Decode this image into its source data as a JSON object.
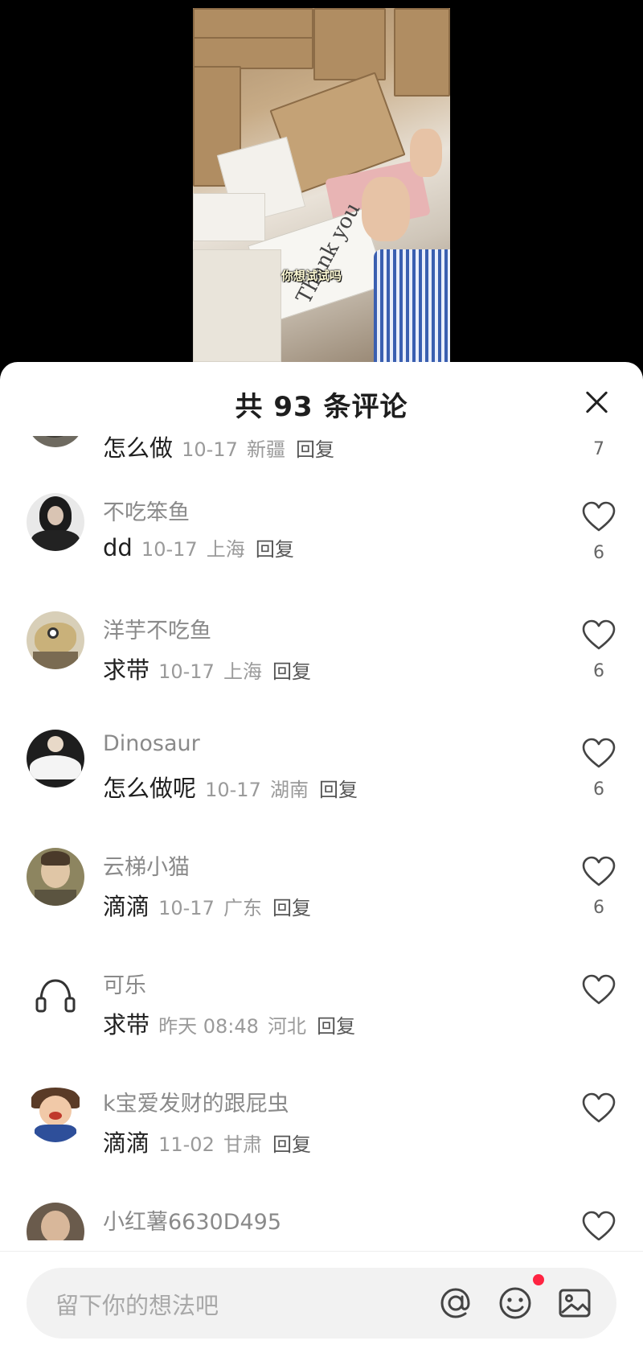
{
  "video": {
    "caption": "你想试试吗",
    "card_text": "Thank you"
  },
  "header": {
    "title": "共 93 条评论"
  },
  "comments": [
    {
      "user": "",
      "text": "怎么做",
      "date": "10-17",
      "location": "新疆",
      "reply": "回复",
      "likes": "7",
      "avatar": "partial-avatar"
    },
    {
      "user": "不吃笨鱼",
      "text": "dd",
      "date": "10-17",
      "location": "上海",
      "reply": "回复",
      "likes": "6",
      "avatar": "woman-portrait"
    },
    {
      "user": "洋芋不吃鱼",
      "text": "求带",
      "date": "10-17",
      "location": "上海",
      "reply": "回复",
      "likes": "6",
      "avatar": "fish-drawing"
    },
    {
      "user": "Dinosaur",
      "text": "怎么做呢",
      "date": "10-17",
      "location": "湖南",
      "reply": "回复",
      "likes": "6",
      "avatar": "dancer"
    },
    {
      "user": "云梯小猫",
      "text": "滴滴",
      "date": "10-17",
      "location": "广东",
      "reply": "回复",
      "likes": "6",
      "avatar": "painting-portrait"
    },
    {
      "user": "可乐",
      "text": "求带",
      "date": "昨天 08:48",
      "location": "河北",
      "reply": "回复",
      "likes": "",
      "avatar": "headphones"
    },
    {
      "user": "k宝爱发财的跟屁虫",
      "text": "滴滴",
      "date": "11-02",
      "location": "甘肃",
      "reply": "回复",
      "likes": "",
      "avatar": "cartoon-character"
    },
    {
      "user": "小红薯6630D495",
      "text": "",
      "date": "",
      "location": "",
      "reply": "",
      "likes": "",
      "avatar": "partial-avatar"
    }
  ],
  "input": {
    "placeholder": "留下你的想法吧"
  },
  "icons": {
    "close": "close-icon",
    "like": "heart-outline-icon",
    "mention": "at-icon",
    "emoji": "smiley-icon",
    "image": "image-icon"
  },
  "colors": {
    "notification_dot": "#ff2442",
    "title": "#1e1e1e",
    "meta": "#9a9a9a"
  }
}
